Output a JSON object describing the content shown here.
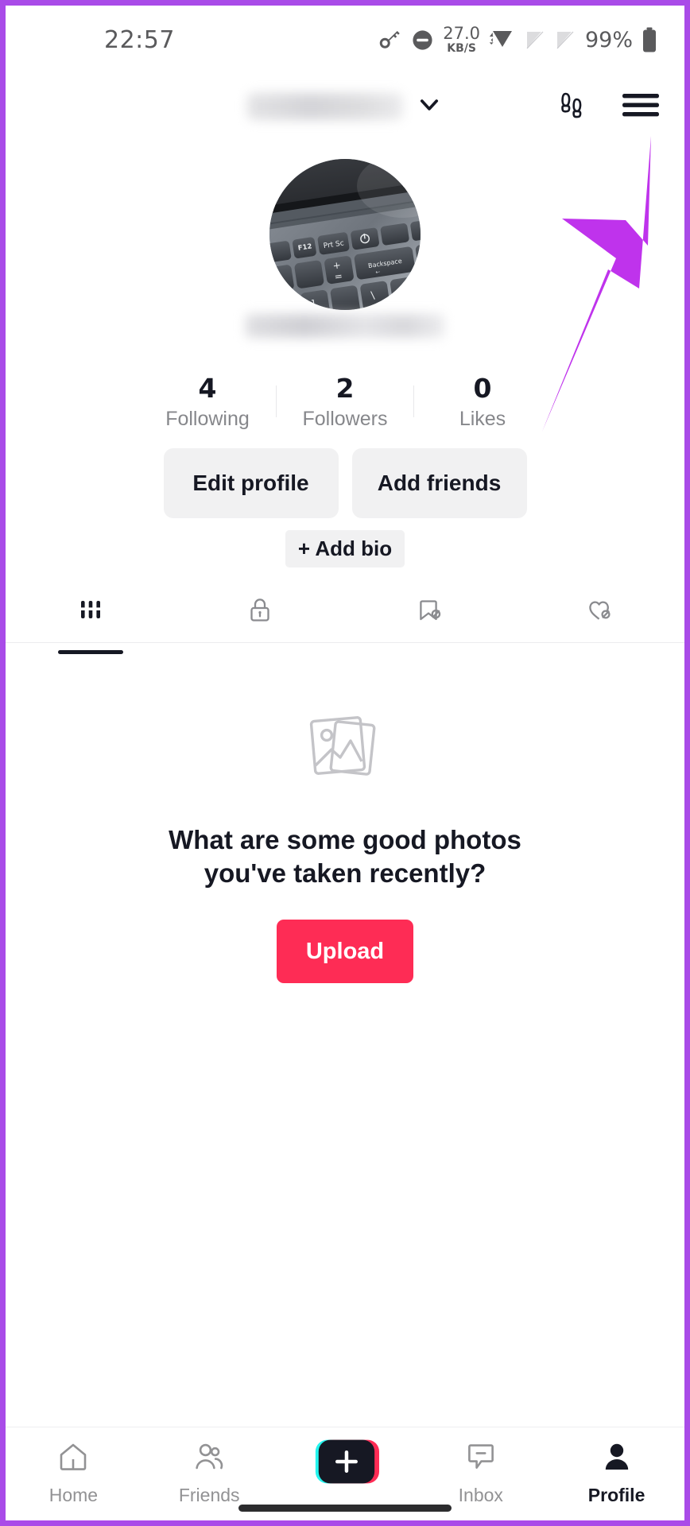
{
  "status_bar": {
    "time": "22:57",
    "network_speed_value": "27.0",
    "network_speed_unit": "KB/S",
    "battery_percent": "99%",
    "icons": [
      "vpn-key-icon",
      "do-not-disturb-icon",
      "network-speed-indicator",
      "wifi-icon",
      "sim-slot-1-empty-icon",
      "sim-slot-2-empty-icon",
      "battery-icon"
    ]
  },
  "profile_header": {
    "username_redacted": "",
    "chevron_icon": "chevron-down-icon",
    "footprints_icon": "footprints-icon",
    "menu_icon": "hamburger-menu-icon"
  },
  "annotation": {
    "type": "arrow",
    "color": "#bf33ec",
    "points_to": "hamburger-menu-icon"
  },
  "avatar": {
    "alt": "laptop-keyboard-photo",
    "keys": [
      "F12",
      "Prt Sc",
      "Backspace",
      "+",
      "="
    ]
  },
  "display_name_redacted": "",
  "stats": [
    {
      "number": "4",
      "label": "Following"
    },
    {
      "number": "2",
      "label": "Followers"
    },
    {
      "number": "0",
      "label": "Likes"
    }
  ],
  "actions": {
    "edit_profile": "Edit profile",
    "add_friends": "Add friends",
    "add_bio": "+ Add bio"
  },
  "content_tabs": [
    {
      "name": "posts-tab",
      "icon": "grid-icon",
      "active": true
    },
    {
      "name": "private-tab",
      "icon": "lock-icon",
      "active": false
    },
    {
      "name": "saved-tab",
      "icon": "bookmark-hidden-icon",
      "active": false
    },
    {
      "name": "liked-tab",
      "icon": "heart-hidden-icon",
      "active": false
    }
  ],
  "empty_state": {
    "icon": "photo-stack-icon",
    "title": "What are some good photos you've taken recently?",
    "upload_label": "Upload"
  },
  "bottom_nav": [
    {
      "label": "Home",
      "icon": "home-icon",
      "active": false
    },
    {
      "label": "Friends",
      "icon": "friends-icon",
      "active": false
    },
    {
      "label": "",
      "icon": "create-plus-icon",
      "active": false
    },
    {
      "label": "Inbox",
      "icon": "inbox-icon",
      "active": false
    },
    {
      "label": "Profile",
      "icon": "profile-person-icon",
      "active": true
    }
  ],
  "colors": {
    "accent_red": "#FE2C55",
    "annotation_purple": "#BF33EC",
    "frame_purple": "#A94BE8",
    "create_cyan": "#25F4EE",
    "create_pink": "#FE2C55",
    "text_primary": "#161823",
    "text_secondary": "#86878B"
  }
}
